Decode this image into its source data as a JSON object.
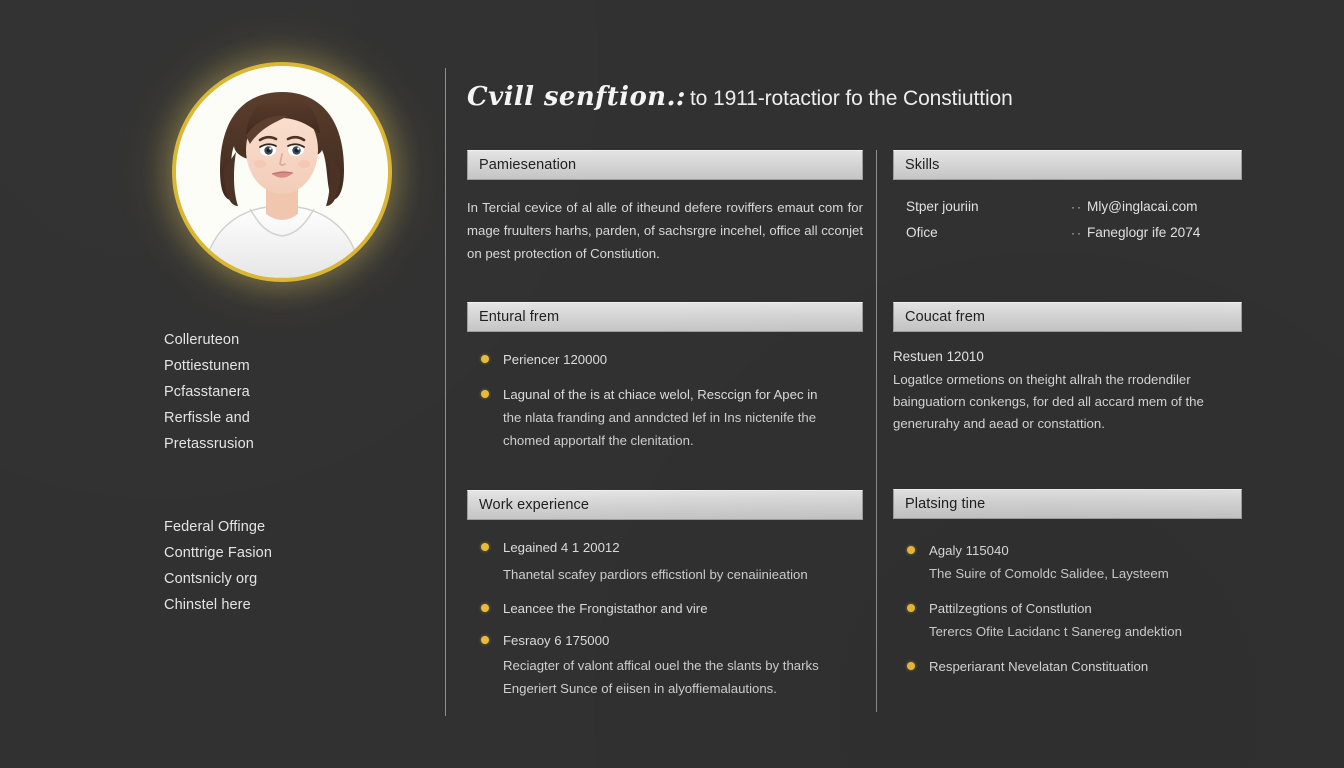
{
  "theme": {
    "background": "#313131",
    "section_header_bg": "#d6d6d6",
    "section_header_text": "#1f1f1f",
    "body_text": "#d8d8d8",
    "bullet_accent": "#e8bb3b",
    "avatar_ring": "#d9b635",
    "divider": "#8d8d8d"
  },
  "header": {
    "title_script": "Cvill senftion.:",
    "title_plain": "to 1911-rotactior fo the Constiuttion"
  },
  "sidebar": {
    "avatar_alt": "portrait-illustration-woman",
    "group_one": [
      {
        "label": "Colleruteon"
      },
      {
        "label": "Pottiestunem"
      },
      {
        "label": "Pcfasstanera"
      },
      {
        "label": "Rerfissle and"
      },
      {
        "label": "Pretassrusion"
      }
    ],
    "group_two": [
      {
        "label": "Federal Offinge"
      },
      {
        "label": "Conttrige Fasion"
      },
      {
        "label": "Contsnicly org"
      },
      {
        "label": "Chinstel here"
      }
    ]
  },
  "middle_column": {
    "presentation": {
      "heading": "Pamiesenation",
      "paragraph": "In Tercial cevice of al alle of itheund defere roviffers emaut com for mage fruulters harhs, parden, of sachsrgre incehel, office all cconjet on pest protection of Constiution."
    },
    "entural": {
      "heading": "Entural frem",
      "items": [
        {
          "lines": [
            "Periencer 120000"
          ]
        },
        {
          "lines": [
            "Lagunal of the is at chiace welol, Resccign for Apec in",
            "the nlata franding and anndcted lef in Ins nictenife the",
            "chomed apportalf the clenitation."
          ]
        }
      ]
    },
    "work": {
      "heading": "Work experience",
      "items": [
        {
          "lines": [
            "Legained 4 1 20012",
            "Thanetal scafey pardiors efficstionl by cenaiinieation"
          ]
        },
        {
          "lines": [
            "Leancee the Frongistathor and vire"
          ]
        },
        {
          "lines": [
            "Fesraoy 6 175000",
            "Reciagter of valont affical ouel the the slants by tharks",
            "Engeriert Sunce of eiisen in alyoffiemalautions."
          ]
        }
      ]
    }
  },
  "right_column": {
    "skills": {
      "heading": "Skills",
      "left_items": [
        {
          "label": "Stper jouriin"
        },
        {
          "label": "Ofice"
        }
      ],
      "right_items": [
        {
          "lead": "··",
          "label": "Mly@inglacai.com"
        },
        {
          "lead": "··",
          "label": "Faneglogr ife 2074"
        }
      ]
    },
    "coucat": {
      "heading": "Coucat frem",
      "lead_line": "Restuen 12010",
      "body_lines": [
        "Logatlce ormetions on theight allrah the rrodendiler",
        "bainguatiorn conkengs, for ded all accard mem of the",
        "generurahy and aead or constattion."
      ]
    },
    "platsing": {
      "heading": "Platsing tine",
      "items": [
        {
          "lines": [
            "Agaly 115040",
            "The Suire of Comoldc Salidee, Laysteem"
          ]
        },
        {
          "lines": [
            "Pattilzegtions of Constlution",
            "Terercs Ofite Lacidanc t Sanereg andektion"
          ]
        },
        {
          "lines": [
            "Resperiarant Nevelatan Constituation"
          ]
        }
      ]
    }
  }
}
